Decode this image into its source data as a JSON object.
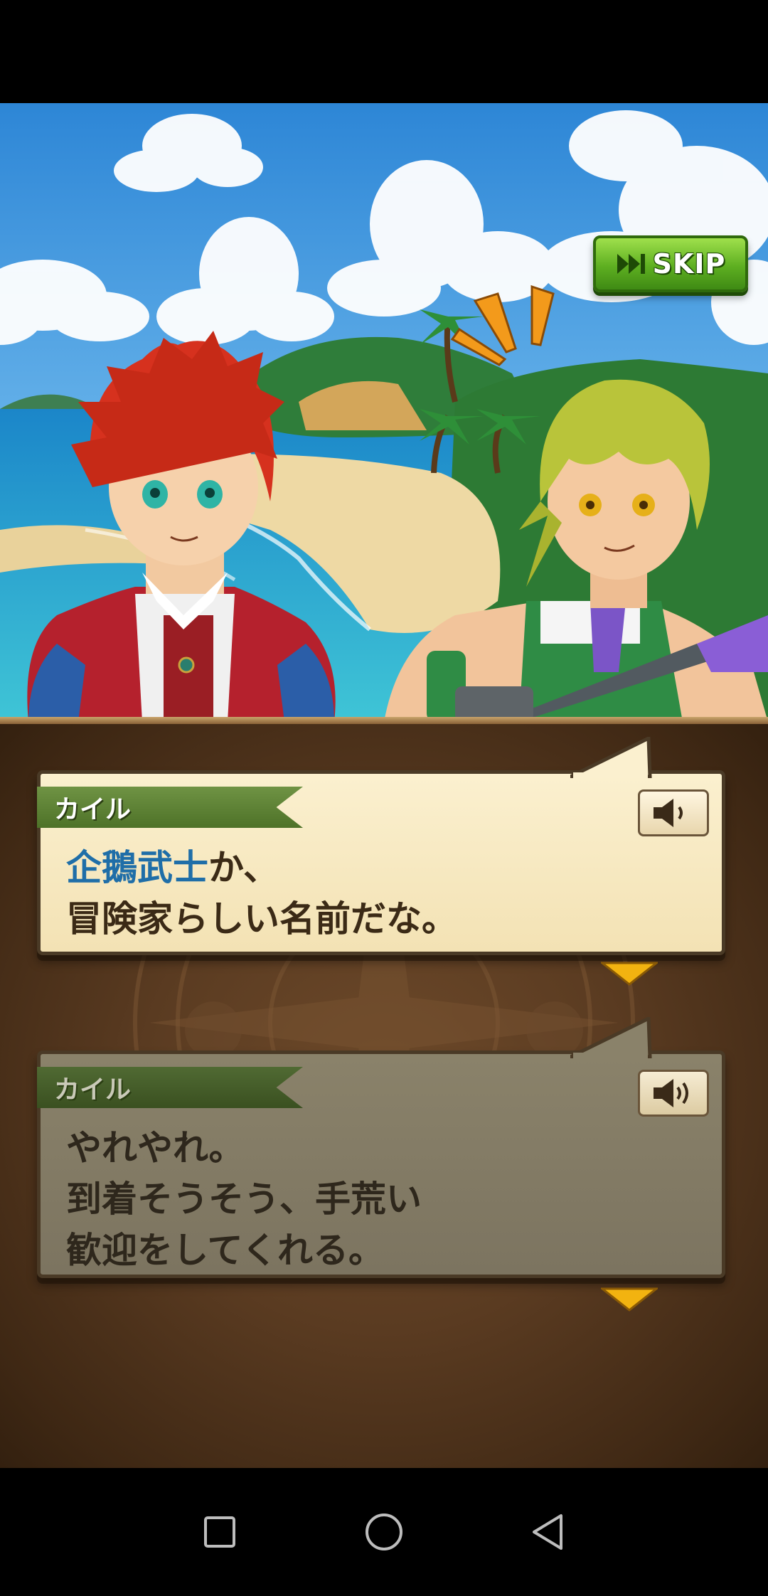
{
  "scene": {
    "skip_button": {
      "label": "SKIP",
      "icon": "fast-forward-icon"
    }
  },
  "dialogues": [
    {
      "state": "active",
      "speaker": "カイル",
      "voice_icon": "speaker-icon",
      "highlight": "企鵝武士",
      "line1_rest": "か、",
      "line2": "冒険家らしい名前だな。"
    },
    {
      "state": "inactive",
      "speaker": "カイル",
      "voice_icon": "speaker-icon",
      "line1": "やれやれ。",
      "line2": "到着そうそう、手荒い",
      "line3": "歓迎をしてくれる。"
    }
  ],
  "nav": {
    "recents_icon": "square-icon",
    "home_icon": "circle-icon",
    "back_icon": "triangle-back-icon"
  },
  "colors": {
    "skip_green": "#5eaf21",
    "name_banner_green": "#5f8336",
    "highlight_blue": "#1f6ea8",
    "arrow_yellow": "#f2b310",
    "panel_brown": "#5a3b21"
  }
}
